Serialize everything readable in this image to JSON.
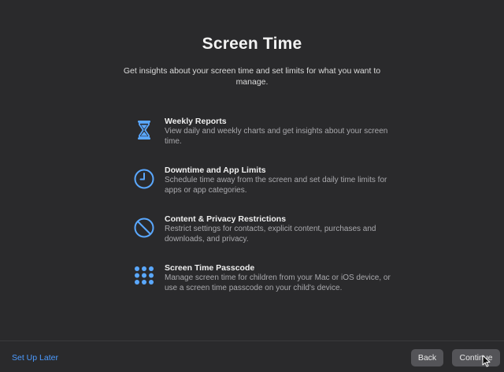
{
  "header": {
    "title": "Screen Time",
    "subtitle": "Get insights about your screen time and set limits for what you want to manage."
  },
  "features": [
    {
      "icon": "hourglass-icon",
      "title": "Weekly Reports",
      "description": "View daily and weekly charts and get insights about your screen time."
    },
    {
      "icon": "clock-icon",
      "title": "Downtime and App Limits",
      "description": "Schedule time away from the screen and set daily time limits for apps or app categories."
    },
    {
      "icon": "restriction-icon",
      "title": "Content & Privacy Restrictions",
      "description": "Restrict settings for contacts, explicit content, purchases and downloads, and privacy."
    },
    {
      "icon": "passcode-grid-icon",
      "title": "Screen Time Passcode",
      "description": "Manage screen time for children from your Mac or iOS device, or use a screen time passcode on your child's device."
    }
  ],
  "footer": {
    "later_label": "Set Up Later",
    "back_label": "Back",
    "continue_label": "Continue"
  },
  "colors": {
    "background": "#2a2a2c",
    "accent_icon": "#5aa8ff",
    "link": "#4c9bff",
    "button": "#545458"
  }
}
